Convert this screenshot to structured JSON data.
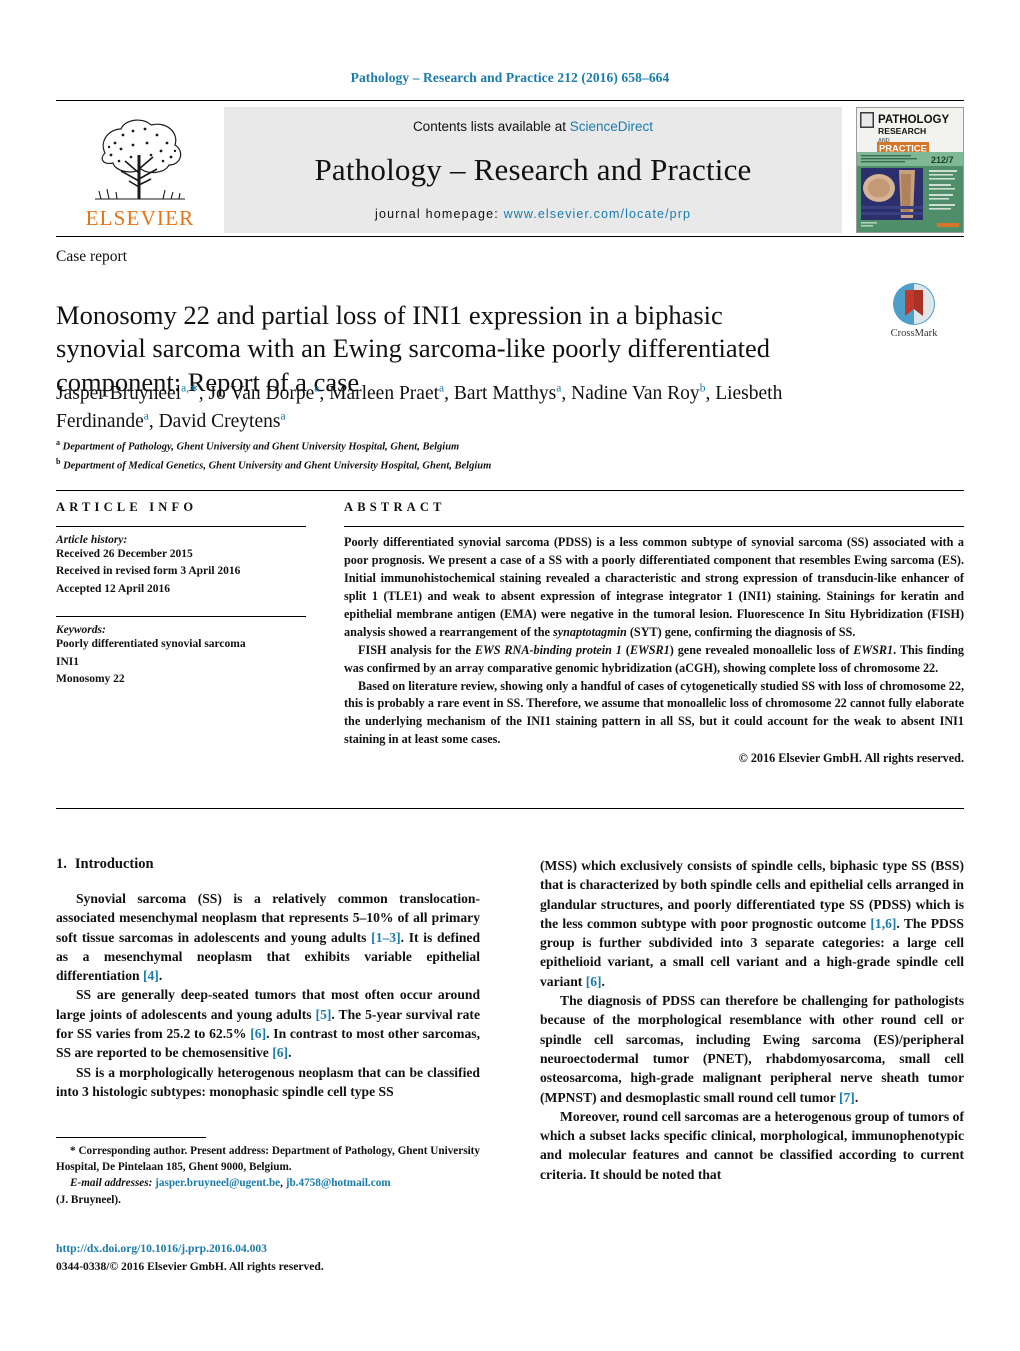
{
  "running_head": "Pathology – Research and Practice 212 (2016) 658–664",
  "masthead": {
    "publisher": "ELSEVIER",
    "contents_prefix": "Contents lists available at ",
    "contents_link": "ScienceDirect",
    "journal_name": "Pathology – Research and Practice",
    "homepage_prefix": "journal homepage: ",
    "homepage_url": "www.elsevier.com/locate/prp",
    "cover": {
      "line1": "PATHOLOGY",
      "line2": "RESEARCH",
      "line3": "AND",
      "line4": "PRACTICE",
      "issue": "212/7"
    }
  },
  "article": {
    "type": "Case report",
    "title": "Monosomy 22 and partial loss of INI1 expression in a biphasic synovial sarcoma with an Ewing sarcoma-like poorly differentiated component: Report of a case",
    "crossmark_label": "CrossMark",
    "authors_line1": "Jasper Bruyneel",
    "authors_html": "Jasper Bruyneel<sup>a,∗</sup>, Jo Van Dorpe<sup>a</sup>, Marleen Praet<sup>a</sup>, Bart Matthys<sup>a</sup>, Nadine Van Roy<sup>b</sup>, Liesbeth Ferdinande<sup>a</sup>, David Creytens<sup>a</sup>",
    "affiliations": [
      "Department of Pathology, Ghent University and Ghent University Hospital, Ghent, Belgium",
      "Department of Medical Genetics, Ghent University and Ghent University Hospital, Ghent, Belgium"
    ],
    "affiliation_marks": [
      "a",
      "b"
    ]
  },
  "info": {
    "heading": "ARTICLE INFO",
    "history_label": "Article history:",
    "history": [
      "Received 26 December 2015",
      "Received in revised form 3 April 2016",
      "Accepted 12 April 2016"
    ],
    "keywords_label": "Keywords:",
    "keywords": [
      "Poorly differentiated synovial sarcoma",
      "INI1",
      "Monosomy 22"
    ]
  },
  "abstract": {
    "heading": "ABSTRACT",
    "paragraphs": [
      "Poorly differentiated synovial sarcoma (PDSS) is a less common subtype of synovial sarcoma (SS) associated with a poor prognosis. We present a case of a SS with a poorly differentiated component that resembles Ewing sarcoma (ES). Initial immunohistochemical staining revealed a characteristic and strong expression of transducin-like enhancer of split 1 (TLE1) and weak to absent expression of integrase integrator 1 (INI1) staining. Stainings for keratin and epithelial membrane antigen (EMA) were negative in the tumoral lesion. Fluorescence In Situ Hybridization (FISH) analysis showed a rearrangement of the synaptotagmin (SYT) gene, confirming the diagnosis of SS.",
      "FISH analysis for the EWS RNA-binding protein 1 (EWSR1) gene revealed monoallelic loss of EWSR1. This finding was confirmed by an array comparative genomic hybridization (aCGH), showing complete loss of chromosome 22.",
      "Based on literature review, showing only a handful of cases of cytogenetically studied SS with loss of chromosome 22, this is probably a rare event in SS. Therefore, we assume that monoallelic loss of chromosome 22 cannot fully elaborate the underlying mechanism of the INI1 staining pattern in all SS, but it could account for the weak to absent INI1 staining in at least some cases."
    ],
    "copyright": "© 2016 Elsevier GmbH. All rights reserved."
  },
  "body": {
    "section_number": "1.",
    "section_title": "Introduction",
    "left_paragraphs": [
      "Synovial sarcoma (SS) is a relatively common translocation-associated mesenchymal neoplasm that represents 5–10% of all primary soft tissue sarcomas in adolescents and young adults [1–3]. It is defined as a mesenchymal neoplasm that exhibits variable epithelial differentiation [4].",
      "SS are generally deep-seated tumors that most often occur around large joints of adolescents and young adults [5]. The 5-year survival rate for SS varies from 25.2 to 62.5% [6]. In contrast to most other sarcomas, SS are reported to be chemosensitive [6].",
      "SS is a morphologically heterogenous neoplasm that can be classified into 3 histologic subtypes: monophasic spindle cell type SS"
    ],
    "right_paragraphs": [
      "(MSS) which exclusively consists of spindle cells, biphasic type SS (BSS) that is characterized by both spindle cells and epithelial cells arranged in glandular structures, and poorly differentiated type SS (PDSS) which is the less common subtype with poor prognostic outcome [1,6]. The PDSS group is further subdivided into 3 separate categories: a large cell epithelioid variant, a small cell variant and a high-grade spindle cell variant [6].",
      "The diagnosis of PDSS can therefore be challenging for pathologists because of the morphological resemblance with other round cell or spindle cell sarcomas, including Ewing sarcoma (ES)/peripheral neuroectodermal tumor (PNET), rhabdomyosarcoma, small cell osteosarcoma, high-grade malignant peripheral nerve sheath tumor (MPNST) and desmoplastic small round cell tumor [7].",
      "Moreover, round cell sarcomas are a heterogenous group of tumors of which a subset lacks specific clinical, morphological, immunophenotypic and molecular features and cannot be classified according to current criteria. It should be noted that"
    ]
  },
  "footnotes": {
    "corresponding": "* Corresponding author. Present address: Department of Pathology, Ghent University Hospital, De Pintelaan 185, Ghent 9000, Belgium.",
    "email_label": "E-mail addresses:",
    "emails": [
      "jasper.bruyneel@ugent.be",
      "jb.4758@hotmail.com"
    ],
    "email_owner": "(J. Bruyneel).",
    "doi": "http://dx.doi.org/10.1016/j.prp.2016.04.003",
    "issn_line": "0344-0338/© 2016 Elsevier GmbH. All rights reserved."
  },
  "colors": {
    "link": "#1a7bad",
    "elsevier_orange": "#e8741a",
    "masthead_bg": "#e9e9e9"
  }
}
